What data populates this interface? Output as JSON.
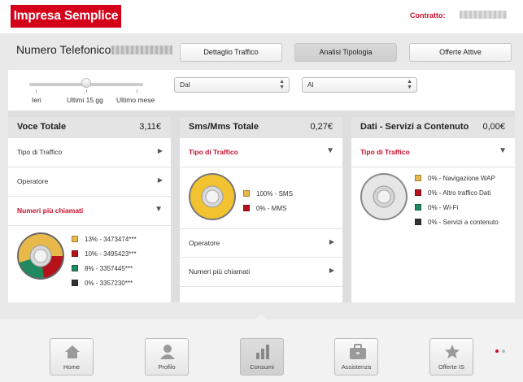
{
  "header": {
    "logo": "Impresa Semplice",
    "contract_label": "Contratto:"
  },
  "number_bar": {
    "label": "Numero Telefonico:",
    "tabs": [
      "Dettaglio Traffico",
      "Analisi Tipologia",
      "Offerte Attive"
    ],
    "active_tab": "Analisi Tipologia"
  },
  "filters": {
    "slider_labels": [
      "Ieri",
      "Ultimi 15 gg",
      "Ultimo mese"
    ],
    "slider_selected": "Ultimi 15 gg",
    "from_select": "Dal",
    "to_select": "Al"
  },
  "cards": {
    "voice": {
      "title": "Voce Totale",
      "total": "3,11€",
      "rows": [
        "Tipo di Traffico",
        "Operatore"
      ],
      "expanded": "Numeri più chiamati",
      "legend": [
        {
          "label": "13% - 3473474***",
          "color": "#e9b84a"
        },
        {
          "label": "10% - 3495423***",
          "color": "#b5121b"
        },
        {
          "label": "8% - 3357445***",
          "color": "#1f8a5f"
        },
        {
          "label": "0% - 3357230***",
          "color": "#333333"
        }
      ]
    },
    "sms": {
      "title": "Sms/Mms Totale",
      "total": "0,27€",
      "expanded": "Tipo di Traffico",
      "legend": [
        {
          "label": "100% - SMS",
          "color": "#e9b84a"
        },
        {
          "label": "0% - MMS",
          "color": "#b5121b"
        }
      ],
      "rows": [
        "Operatore",
        "Numeri più chiamati"
      ]
    },
    "data": {
      "title": "Dati - Servizi a Contenuto",
      "total": "0,00€",
      "expanded": "Tipo di Traffico",
      "legend": [
        {
          "label": "0% - Navigazione WAP",
          "color": "#e9b84a"
        },
        {
          "label": "0% - Altro traffico Dati",
          "color": "#b5121b"
        },
        {
          "label": "0% - Wi-Fi",
          "color": "#1f8a5f"
        },
        {
          "label": "0% - Servizi a contenuto",
          "color": "#333333"
        }
      ]
    }
  },
  "nav": {
    "items": [
      "Home",
      "Profilo",
      "Consumi",
      "Assistenza",
      "Offerte IS"
    ],
    "active": "Consumi"
  },
  "colors": {
    "brand_red": "#d4001a",
    "accent_red": "#c8102e"
  }
}
